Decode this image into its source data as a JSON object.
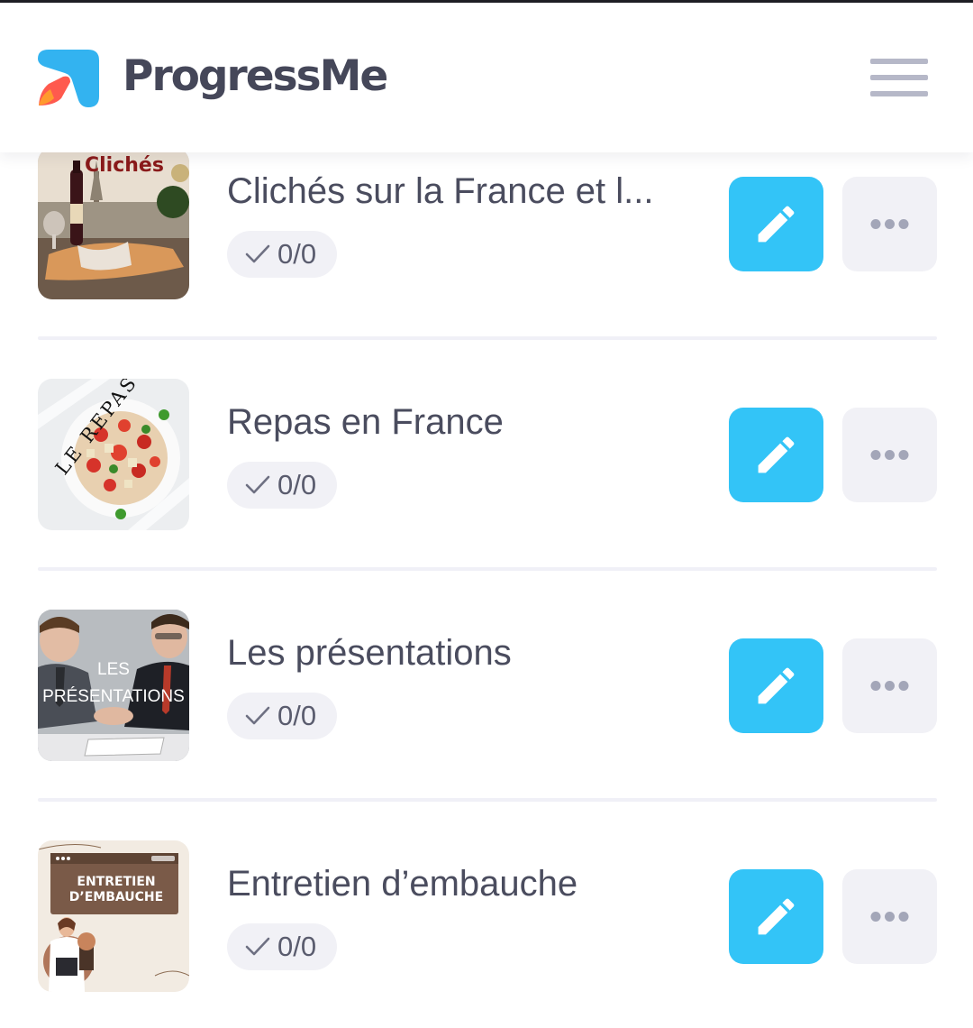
{
  "app": {
    "brand": "ProgressMe",
    "logo_icon": "progressme-logo-icon",
    "menu_icon": "hamburger-menu-icon"
  },
  "colors": {
    "accent": "#33c4f7",
    "brand_text": "#454759",
    "badge_bg": "#f1f1f6",
    "divider": "#f0f0f7"
  },
  "lessons": [
    {
      "title": "Clichés sur la France et l...",
      "progress": "0/0",
      "thumbnail_text": "Clichés",
      "edit_icon": "pencil-icon",
      "more_icon": "more-dots-icon"
    },
    {
      "title": "Repas en France",
      "progress": "0/0",
      "thumbnail_text": "LE REPAS",
      "edit_icon": "pencil-icon",
      "more_icon": "more-dots-icon"
    },
    {
      "title": "Les présentations",
      "progress": "0/0",
      "thumbnail_text_1": "LES",
      "thumbnail_text_2": "PRÉSENTATIONS",
      "edit_icon": "pencil-icon",
      "more_icon": "more-dots-icon"
    },
    {
      "title": "Entretien d’embauche",
      "progress": "0/0",
      "thumbnail_text_1": "ENTRETIEN",
      "thumbnail_text_2": "D’EMBAUCHE",
      "edit_icon": "pencil-icon",
      "more_icon": "more-dots-icon"
    }
  ]
}
